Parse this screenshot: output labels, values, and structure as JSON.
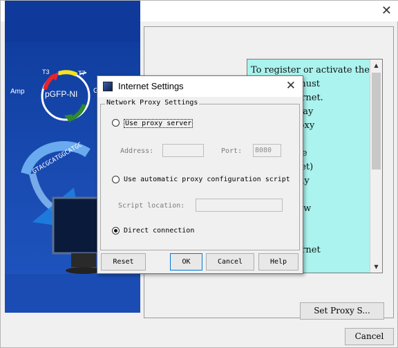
{
  "main": {
    "info_text": "To register or activate the\ncomputer must\n to the Internet.\nrewall, it may\nrough a proxy\n acts as an\nbetween the\nork (Intranet)\nnet. You may\ne required\ndetails below\nstem\n\n to the Internet\nxy server:",
    "set_proxy_label": "Set Proxy S...",
    "cancel_label": "Cancel"
  },
  "graphic": {
    "plasmid_label": "pGFP-NI",
    "amp_label": "Amp",
    "t3_label": "T3",
    "t7_label": "T7",
    "g_label": "G",
    "dna_letters": "GTACGCATGGCATGC"
  },
  "dialog": {
    "title": "Internet Settings",
    "group_label": "Network Proxy Settings",
    "use_proxy_label": "Use proxy server",
    "address_label": "Address:",
    "address_value": "",
    "port_label": "Port:",
    "port_value": "8080",
    "auto_config_label": "Use automatic proxy configuration script",
    "script_location_label": "Script location:",
    "script_location_value": "",
    "direct_label": "Direct connection",
    "selected_option": "direct",
    "reset_label": "Reset",
    "ok_label": "OK",
    "cancel_label": "Cancel",
    "help_label": "Help"
  }
}
